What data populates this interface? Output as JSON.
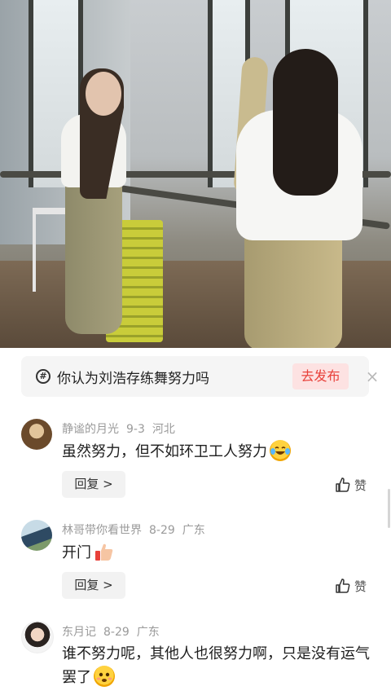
{
  "topic": {
    "text": "你认为刘浩存练舞努力吗",
    "publish_label": "去发布",
    "close_glyph": "×",
    "hash_glyph": "#"
  },
  "comments": [
    {
      "username": "静谧的月光",
      "date": "9-3",
      "location": "河北",
      "text": "虽然努力，但不如环卫工人努力",
      "emoji": "laughing-tears-emoji",
      "reply_label": "回复 >",
      "like_label": "赞"
    },
    {
      "username": "林哥带你看世界",
      "date": "8-29",
      "location": "广东",
      "text": "开门",
      "emoji": "thumbs-up-emoji",
      "reply_label": "回复 >",
      "like_label": "赞"
    },
    {
      "username": "东月记",
      "date": "8-29",
      "location": "广东",
      "text": "谁不努力呢，其他人也很努力啊，只是没有运气罢了",
      "emoji": "shy-smile-emoji"
    }
  ],
  "colors": {
    "accent_red": "#e8413a",
    "publish_bg": "#fde2e2",
    "meta_gray": "#9a9a9a"
  }
}
